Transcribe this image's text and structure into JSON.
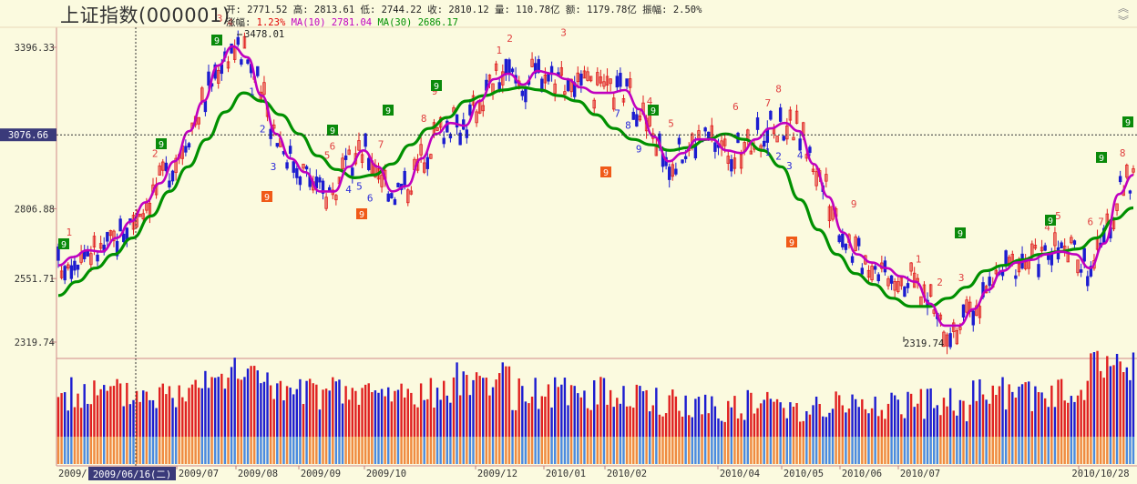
{
  "header": {
    "title": "上证指数(000001)",
    "open_label": "开:",
    "open": "2771.52",
    "high_label": "高:",
    "high": "2813.61",
    "low_label": "低:",
    "low": "2744.22",
    "close_label": "收:",
    "close": "2810.12",
    "volume_label": "量:",
    "volume": "110.78亿",
    "amount_label": "额:",
    "amount": "1179.78亿",
    "amplitude_label": "振幅:",
    "amplitude": "2.50%",
    "change_label": "涨幅:",
    "change": "1.23%",
    "ma10_label": "MA(10)",
    "ma10": "2781.04",
    "ma30_label": "MA(30)",
    "ma30": "2686.17"
  },
  "chart_data": {
    "type": "candlestick",
    "y_ticks": [
      "3396.33",
      "3076.66",
      "2806.88",
      "2551.71",
      "2319.74"
    ],
    "y_tick_values": [
      3396.33,
      3076.66,
      2806.88,
      2551.71,
      2319.74
    ],
    "ylim": [
      2200,
      3560
    ],
    "crosshair_value": "3076.66",
    "crosshair_date": "2009/06/16(二)",
    "max_annotation": "3478.01",
    "min_annotation": "2319.74",
    "x_ticks": [
      "2009/07",
      "2009/08",
      "2009/09",
      "2009/10",
      "2009/12",
      "2010/01",
      "2010/02",
      "2010/04",
      "2010/05",
      "2010/06",
      "2010/07",
      "2010/10/28"
    ],
    "ma10_path_values": [
      2600,
      2630,
      2655,
      2650,
      2700,
      2760,
      2830,
      2900,
      2980,
      3090,
      3200,
      3330,
      3400,
      3360,
      3220,
      3080,
      2990,
      2940,
      2870,
      2870,
      2960,
      3020,
      2960,
      2870,
      2890,
      2990,
      3080,
      3120,
      3110,
      3200,
      3280,
      3300,
      3260,
      3310,
      3300,
      3280,
      3250,
      3230,
      3230,
      3240,
      3170,
      3070,
      2980,
      3010,
      3060,
      3060,
      3020,
      3010,
      3060,
      3100,
      3120,
      3090,
      2970,
      2850,
      2720,
      2640,
      2610,
      2590,
      2560,
      2540,
      2460,
      2380,
      2380,
      2440,
      2510,
      2580,
      2610,
      2620,
      2640,
      2650,
      2640,
      2590,
      2680,
      2860,
      2930
    ],
    "ma30_path_values": [
      2490,
      2540,
      2590,
      2640,
      2700,
      2780,
      2870,
      2960,
      3060,
      3160,
      3230,
      3200,
      3150,
      3080,
      3000,
      2950,
      2920,
      2930,
      2970,
      3040,
      3100,
      3140,
      3200,
      3220,
      3240,
      3250,
      3240,
      3220,
      3200,
      3150,
      3100,
      3060,
      3040,
      3020,
      3030,
      3060,
      3080,
      3060,
      3020,
      2960,
      2840,
      2730,
      2640,
      2570,
      2530,
      2480,
      2450,
      2450,
      2480,
      2520,
      2580,
      2600,
      2620,
      2640,
      2650,
      2660,
      2700,
      2770,
      2810
    ],
    "ma_colors": {
      "ma10": "#c000c0",
      "ma30": "#009000"
    },
    "candle_colors": {
      "up": "#e02020",
      "down": "#1c1cd0"
    },
    "td_up_labels": [
      "1",
      "2",
      "3",
      "4",
      "5",
      "6",
      "7",
      "8",
      "9"
    ],
    "td_down_labels": [
      "1",
      "2",
      "3",
      "4",
      "5",
      "6",
      "7",
      "8",
      "9"
    ],
    "grid": false
  }
}
